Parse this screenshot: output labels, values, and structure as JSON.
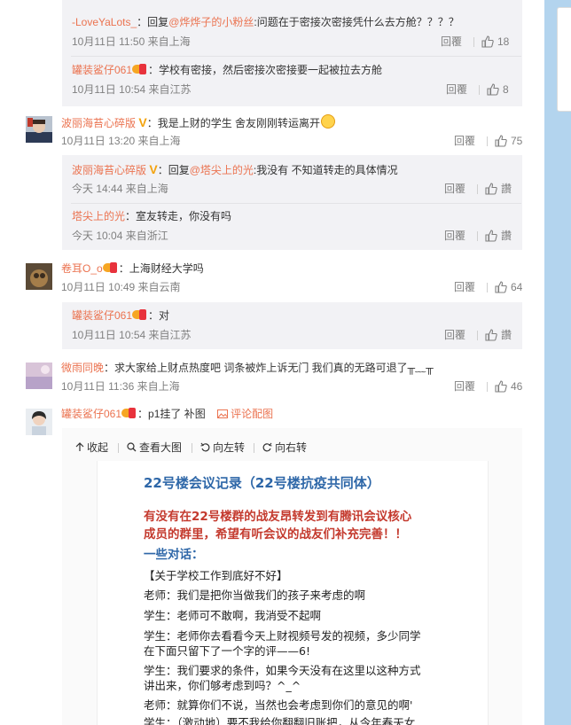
{
  "replies_top": [
    {
      "name": "-LoveYaLots_",
      "text_prefix": "：回复",
      "at": "@烨烨子的小粉丝",
      "text": ":问题在于密接次密接凭什么去方舱？？？？",
      "time": "10月11日 11:50 来自上海",
      "reply_label": "回覆",
      "likes": "18"
    },
    {
      "name": "罐装鲨仔061",
      "text": "：学校有密接，然后密接次密接要一起被拉去方舱",
      "time": "10月11日 10:54 来自江苏",
      "reply_label": "回覆",
      "likes": "8"
    }
  ],
  "comments": [
    {
      "name": "波丽海苔心碎版",
      "badge": "V",
      "text": "：我是上财的学生 舍友刚刚转运离开",
      "time": "10月11日 13:20 来自上海",
      "reply_label": "回覆",
      "likes": "75",
      "replies": [
        {
          "name": "波丽海苔心碎版",
          "badge": "V",
          "text_prefix": "：回复",
          "at": "@塔尖上的光",
          "text": ":我没有 不知道转走的具体情况",
          "time": "今天 14:44 来自上海",
          "reply_label": "回覆",
          "likes": "讚"
        },
        {
          "name": "塔尖上的光",
          "text": "：室友转走，你没有吗",
          "time": "今天 10:04 来自浙江",
          "reply_label": "回覆",
          "likes": "讚"
        }
      ]
    },
    {
      "name": "卷耳O_o",
      "text": "：上海财经大学吗",
      "time": "10月11日 10:49 来自云南",
      "reply_label": "回覆",
      "likes": "64",
      "replies": [
        {
          "name": "罐装鲨仔061",
          "text": "：对",
          "time": "10月11日 10:54 来自江苏",
          "reply_label": "回覆",
          "likes": "讚"
        }
      ]
    },
    {
      "name": "微雨同晚",
      "text": "：求大家给上财点热度吧 词条被炸上诉无门 我们真的无路可退了╥﹏╥",
      "time": "10月11日 11:36 来自上海",
      "reply_label": "回覆",
      "likes": "46"
    },
    {
      "name": "罐装鲨仔061",
      "text": "：p1挂了 补图",
      "comment_pic_label": "评论配图"
    }
  ],
  "image_toolbar": {
    "collapse": "收起",
    "view_large": "查看大图",
    "rotate_left": "向左转",
    "rotate_right": "向右转"
  },
  "document": {
    "title": "22号楼会议记录（22号楼抗疫共同体）",
    "notice_line1": "有没有在22号楼群的战友昂转发到有腾讯会议核心",
    "notice_line2": "成员的群里，希望有听会议的战友们补充完善！！",
    "subtitle": "一些对话：",
    "lines": [
      "【关于学校工作到底好不好】",
      "老师：我们是把你当做我们的孩子来考虑的啊",
      "学生：老师可不敢啊，我消受不起啊",
      "学生：老师你去看看今天上财视频号发的视频，多少同学",
      "在下面只留下了一个字的评——6!",
      "学生：我们要求的条件，如果今天没有在这里以这种方式",
      "讲出来，你们够考虑到吗？^_^",
      "老师：就算你们不说，当然也会考虑到你们的意见的啊'",
      "学生：（激动地）要不我给你翻翻旧账把，从今年春天女"
    ]
  }
}
